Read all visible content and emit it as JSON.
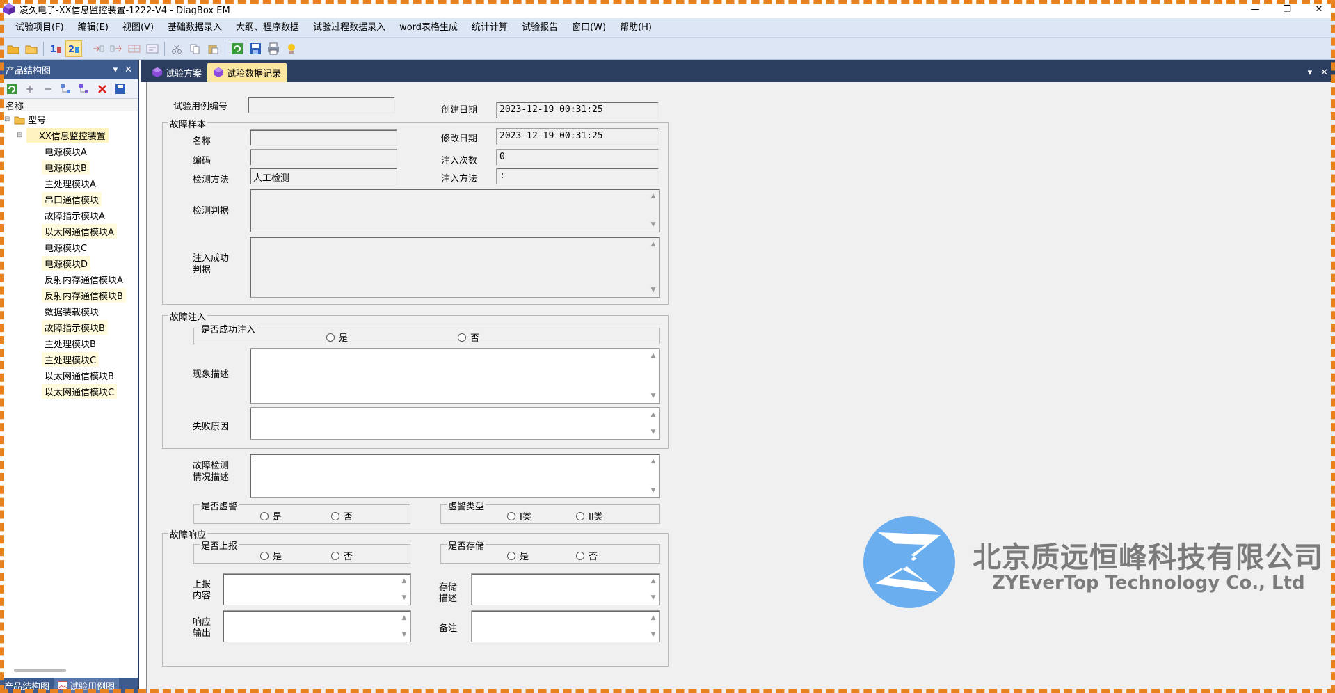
{
  "window": {
    "title": "凌久电子-XX信息监控装置-1222-V4 - DiagBox EM",
    "controls": {
      "minimize": "—",
      "restore": "❐",
      "close": "✕"
    }
  },
  "menubar": {
    "items": [
      "试验项目(F)",
      "编辑(E)",
      "视图(V)",
      "基础数据录入",
      "大纲、程序数据",
      "试验过程数据录入",
      "word表格生成",
      "统计计算",
      "试验报告",
      "窗口(W)",
      "帮助(H)"
    ]
  },
  "dock": {
    "title": "产品结构图",
    "column_header": "名称",
    "root": "型号",
    "device": "XX信息监控装置",
    "modules": [
      "电源模块A",
      "电源模块B",
      "主处理模块A",
      "串口通信模块",
      "故障指示模块A",
      "以太网通信模块A",
      "电源模块C",
      "电源模块D",
      "反射内存通信模块A",
      "反射内存通信模块B",
      "数据装载模块",
      "故障指示模块B",
      "主处理模块B",
      "主处理模块C",
      "以太网通信模块B",
      "以太网通信模块C"
    ],
    "footer_tabs": [
      "产品结构图",
      "试验用例图"
    ]
  },
  "doc_tabs": [
    "试验方案",
    "试验数据记录"
  ],
  "form": {
    "case_no_label": "试验用例编号",
    "case_no_value": "",
    "create_date_label": "创建日期",
    "create_date_value": "2023-12-19 00:31:25",
    "fault_sample": {
      "title": "故障样本",
      "name_label": "名称",
      "name_value": "",
      "code_label": "编码",
      "code_value": "",
      "detect_method_label": "检测方法",
      "detect_method_value": "人工检测",
      "modify_date_label": "修改日期",
      "modify_date_value": "2023-12-19 00:31:25",
      "inject_count_label": "注入次数",
      "inject_count_value": "0",
      "inject_method_label": "注入方法",
      "inject_method_value": ":",
      "detect_criteria_label": "检测判据",
      "inject_success_label_1": "注入成功",
      "inject_success_label_2": "判据"
    },
    "fault_injection": {
      "title": "故障注入",
      "success_group": "是否成功注入",
      "yes": "是",
      "no": "否",
      "phenomenon_label": "现象描述",
      "fail_reason_label": "失败原因"
    },
    "detection_desc_label_1": "故障检测",
    "detection_desc_label_2": "情况描述",
    "false_alarm": {
      "title": "是否虚警",
      "yes": "是",
      "no": "否"
    },
    "false_alarm_type": {
      "title": "虚警类型",
      "type1": "I类",
      "type2": "II类"
    },
    "fault_response": {
      "title": "故障响应",
      "report_group": "是否上报",
      "store_group": "是否存储",
      "yes": "是",
      "no": "否",
      "report_content_label_1": "上报",
      "report_content_label_2": "内容",
      "store_desc_label_1": "存储",
      "store_desc_label_2": "描述",
      "response_output_label_1": "响应",
      "response_output_label_2": "输出",
      "remark_label": "备注"
    }
  },
  "watermark": {
    "cn": "北京质远恒峰科技有限公司",
    "en": "ZYEverTop Technology Co., Ltd",
    "color": "#7b7b7b",
    "logo_color": "#6aaef0"
  }
}
